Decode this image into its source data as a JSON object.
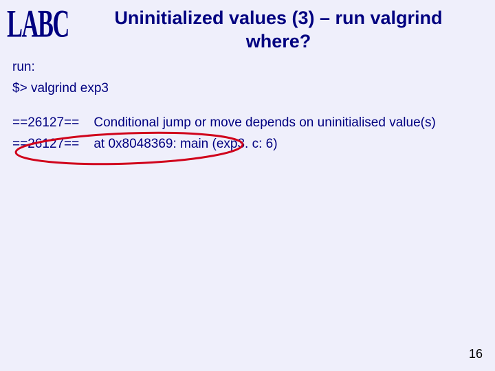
{
  "logo": "LABC",
  "title": "Uninitialized values (3) – run valgrind where?",
  "run_label": "run:",
  "command": "$>  valgrind exp3",
  "output": [
    {
      "pid": "==26127==",
      "msg": "Conditional jump or move depends on uninitialised value(s)"
    },
    {
      "pid": "==26127==",
      "msg": "at 0x8048369: main (exp3. c: 6)"
    }
  ],
  "page_number": "16",
  "annot_color": "#d0021b"
}
